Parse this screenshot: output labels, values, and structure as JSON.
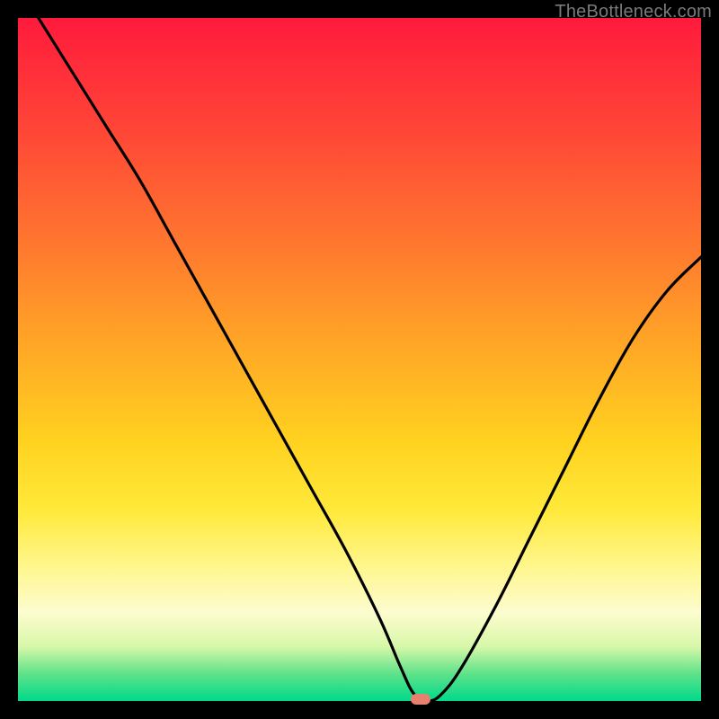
{
  "watermark": "TheBottleneck.com",
  "colors": {
    "frame": "#000000",
    "gradient_stops": [
      "#ff1a3c",
      "#ff2a3a",
      "#ff4a36",
      "#ff7a2e",
      "#ffa726",
      "#ffd21f",
      "#ffe93a",
      "#fff68a",
      "#fdfccf",
      "#d7f8a8",
      "#5fe28a",
      "#00d98a"
    ],
    "curve": "#000000",
    "min_marker": "#e7806f"
  },
  "chart_data": {
    "type": "line",
    "title": "",
    "xlabel": "",
    "ylabel": "",
    "xlim": [
      0,
      100
    ],
    "ylim": [
      0,
      100
    ],
    "legend": false,
    "grid": false,
    "annotations": [
      {
        "kind": "min-marker",
        "x": 59,
        "y": 0
      }
    ],
    "series": [
      {
        "name": "bottleneck-curve",
        "x": [
          3,
          8,
          13,
          18,
          23,
          28,
          33,
          38,
          43,
          48,
          53,
          56,
          58,
          60,
          62,
          65,
          70,
          75,
          80,
          85,
          90,
          95,
          100
        ],
        "values": [
          100,
          92,
          84,
          76,
          67,
          58,
          49,
          40,
          31,
          22,
          12,
          5,
          1,
          0,
          1,
          5,
          14,
          24,
          34,
          44,
          53,
          60,
          65
        ]
      }
    ]
  }
}
